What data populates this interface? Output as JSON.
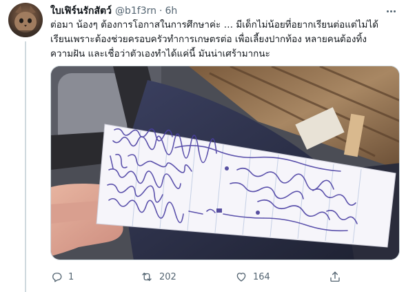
{
  "tweet": {
    "display_name": "ใบเฟิร์นรักสัตว์",
    "handle": "@b1f3rn",
    "separator": "·",
    "time": "6h",
    "text_lines": [
      "ต่อมา น้องๆ ต้องการโอกาสในการศึกษาค่ะ … มีเด็กไม่น้อยที่อยากเรียนต่อแต่ไม่ได้",
      "เรียนเพราะต้องช่วยครอบครัวทำการเกษตรต่อ เพื่อเลี้ยงปากท้อง หลายคนต้องทิ้ง",
      "ความฝัน และเชื่อว่าตัวเองทำได้แค่นี้  มันน่าเศร้ามากนะ"
    ]
  },
  "actions": {
    "reply_count": "1",
    "retweet_count": "202",
    "like_count": "164"
  },
  "icons": {
    "avatar": "cat-avatar",
    "more": "more-icon",
    "reply": "reply-icon",
    "retweet": "retweet-icon",
    "like": "heart-icon",
    "share": "share-icon"
  },
  "colors": {
    "text": "#0f1419",
    "secondary": "#536471",
    "border": "#cfd9de",
    "ink": "#4a3fa3"
  }
}
